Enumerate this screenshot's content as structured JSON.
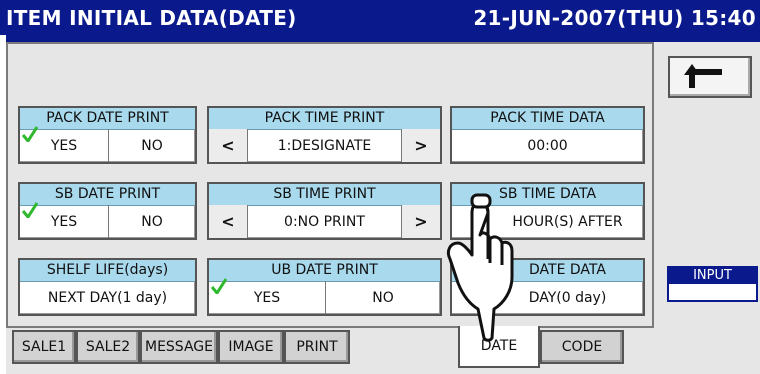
{
  "title": "ITEM INITIAL DATA(DATE)",
  "datetime": "21-JUN-2007(THU) 15:40",
  "groups": {
    "pack_date_print": {
      "label": "PACK DATE PRINT",
      "options": [
        "YES",
        "NO"
      ],
      "selected": "YES"
    },
    "pack_time_print": {
      "label": "PACK TIME PRINT",
      "value": "1:DESIGNATE",
      "prev": "<",
      "next": ">"
    },
    "pack_time_data": {
      "label": "PACK TIME DATA",
      "value": "00:00"
    },
    "sb_date_print": {
      "label": "SB DATE PRINT",
      "options": [
        "YES",
        "NO"
      ],
      "selected": "YES"
    },
    "sb_time_print": {
      "label": "SB TIME PRINT",
      "value": "0:NO PRINT",
      "prev": "<",
      "next": ">"
    },
    "sb_time_data": {
      "label": "SB TIME DATA",
      "value": "HOUR(S) AFTER"
    },
    "shelf_life": {
      "label": "SHELF LIFE(days)",
      "value": "NEXT DAY(1 day)"
    },
    "ub_date_print": {
      "label": "UB DATE PRINT",
      "options": [
        "YES",
        "NO"
      ],
      "selected": "YES"
    },
    "ub_date_data": {
      "label": "DATE DATA",
      "value": "DAY(0 day)"
    }
  },
  "side": {
    "input_label": "INPUT",
    "back_icon": "return-arrow-icon"
  },
  "tabs": [
    {
      "label": "SALE1",
      "active": false
    },
    {
      "label": "SALE2",
      "active": false
    },
    {
      "label": "MESSAGE",
      "active": false
    },
    {
      "label": "IMAGE",
      "active": false
    },
    {
      "label": "PRINT",
      "active": false
    },
    {
      "label": "DATE",
      "active": true
    },
    {
      "label": "CODE",
      "active": false
    }
  ],
  "colors": {
    "title_bg": "#0a1a8c",
    "header_bg": "#a9d9ec",
    "panel_bg": "#e6e6e6",
    "check": "#2db82d"
  }
}
